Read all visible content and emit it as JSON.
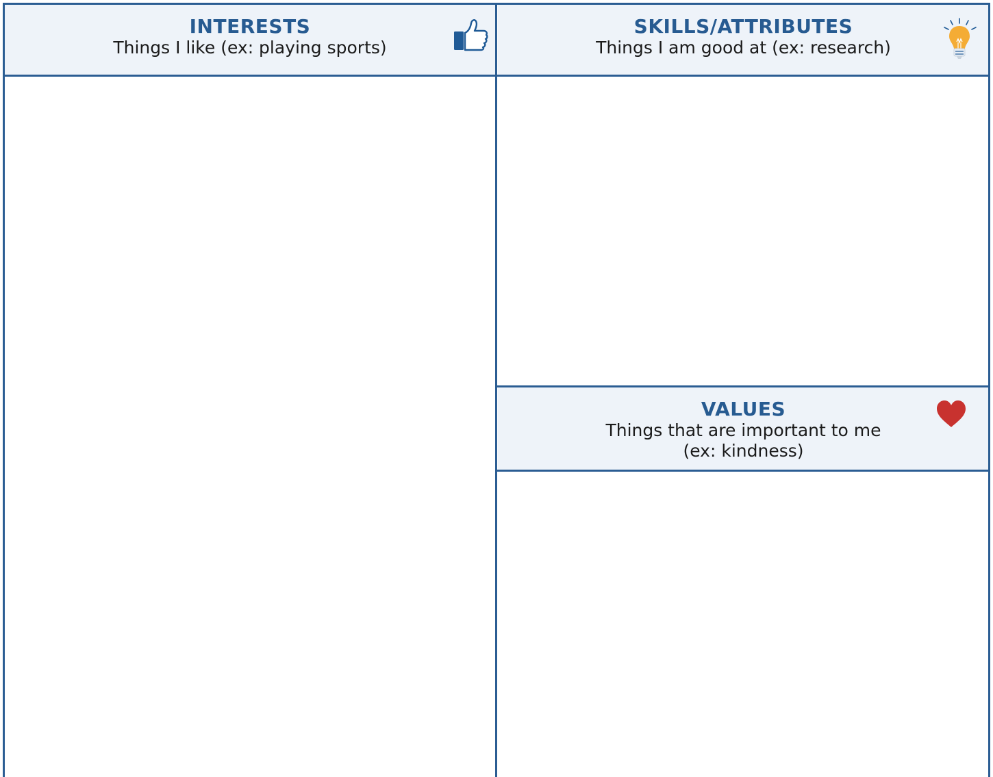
{
  "colors": {
    "border": "#2b5d93",
    "header_bg": "#eef3f9",
    "title": "#275b91",
    "heart": "#c8322f",
    "bulb": "#f4ac35"
  },
  "interests": {
    "title": "INTERESTS",
    "subtitle": "Things I like (ex: playing sports)",
    "icon": "thumbs-up-icon"
  },
  "skills": {
    "title": "SKILLS/ATTRIBUTES",
    "subtitle": "Things I am good at (ex: research)",
    "icon": "lightbulb-icon"
  },
  "values": {
    "title": "VALUES",
    "subtitle_line1": "Things that are important to me",
    "subtitle_line2": "(ex: kindness)",
    "icon": "heart-icon"
  }
}
